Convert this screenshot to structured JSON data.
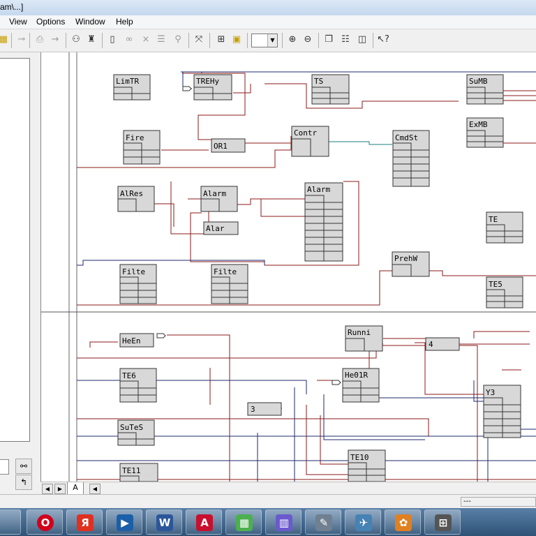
{
  "window": {
    "title": "am\\...]"
  },
  "menu": {
    "items": [
      "View",
      "Options",
      "Window",
      "Help"
    ]
  },
  "toolbar": {
    "zoom_value": "",
    "icons": [
      "grid-icon",
      "pin-icon",
      "pin-remove-icon",
      "print-icon",
      "arrow-in-icon",
      "variables-icon",
      "hierarchy-icon",
      "page-icon",
      "link-icon",
      "unlink-icon",
      "list-icon",
      "tree-icon",
      "fit-icon",
      "table-icon",
      "frame-icon",
      "zoom-in-icon",
      "zoom-out-icon",
      "cascade-icon",
      "tile-horizontal-icon",
      "tile-vertical-icon",
      "context-help-icon"
    ]
  },
  "diagram": {
    "blocks": [
      {
        "label": "LimTR"
      },
      {
        "label": "TREHy"
      },
      {
        "label": "TS"
      },
      {
        "label": "SuMB"
      },
      {
        "label": "Fire"
      },
      {
        "label": "OR1"
      },
      {
        "label": "Contr"
      },
      {
        "label": "CmdSt"
      },
      {
        "label": "ExMB"
      },
      {
        "label": "AlRes"
      },
      {
        "label": "Alarm"
      },
      {
        "label": "Alarm"
      },
      {
        "label": "Alar"
      },
      {
        "label": "TE"
      },
      {
        "label": "Filte"
      },
      {
        "label": "Filte"
      },
      {
        "label": "PrehW"
      },
      {
        "label": "TE5"
      },
      {
        "label": "HeEn"
      },
      {
        "label": "Runni"
      },
      {
        "label": "4"
      },
      {
        "label": "TE6"
      },
      {
        "label": "He01R"
      },
      {
        "label": "Y3"
      },
      {
        "label": "3"
      },
      {
        "label": "SuTeS"
      },
      {
        "label": "TE10"
      },
      {
        "label": "TE11"
      }
    ]
  },
  "sheet_tab": {
    "label": "A"
  },
  "status": {
    "panel": "---"
  },
  "taskbar": {
    "apps": [
      {
        "name": "opera-icon",
        "glyph": "O",
        "color": "#d0021b"
      },
      {
        "name": "yandex-browser-icon",
        "glyph": "Я",
        "color": "#e03020"
      },
      {
        "name": "media-center-icon",
        "glyph": "▶",
        "color": "#1b5fa8"
      },
      {
        "name": "word-icon",
        "glyph": "W",
        "color": "#2b579a"
      },
      {
        "name": "pdf-reader-icon",
        "glyph": "A",
        "color": "#c8102e"
      },
      {
        "name": "blocks-game-icon",
        "glyph": "▦",
        "color": "#4caf50"
      },
      {
        "name": "chart-app-icon",
        "glyph": "▥",
        "color": "#6a5acd"
      },
      {
        "name": "editor-icon",
        "glyph": "✎",
        "color": "#708090"
      },
      {
        "name": "satellite-icon",
        "glyph": "✈",
        "color": "#4682b4"
      },
      {
        "name": "paint-icon",
        "glyph": "✿",
        "color": "#e08020"
      },
      {
        "name": "fbd-editor-icon",
        "glyph": "⊞",
        "color": "#555555"
      }
    ]
  }
}
